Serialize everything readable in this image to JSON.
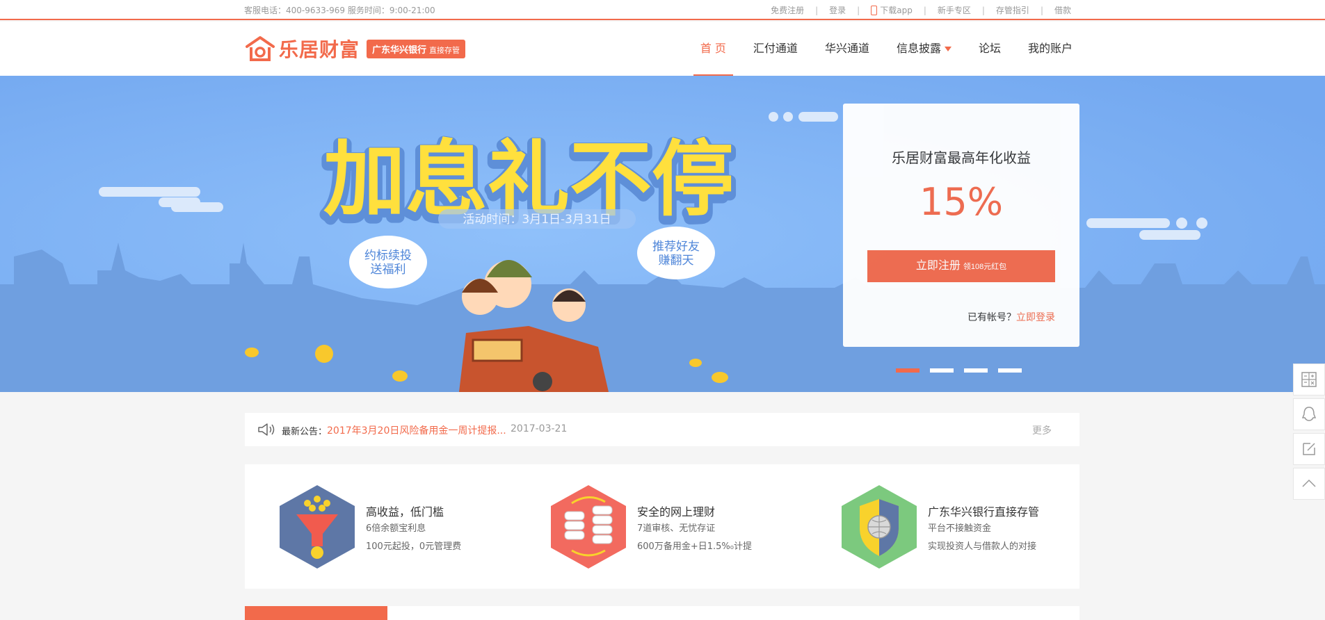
{
  "topbar": {
    "hotline": "客服电话：400-9633-969   服务时间：9:00-21:00",
    "links": [
      "免费注册",
      "登录",
      "下载app",
      "新手专区",
      "存管指引",
      "借款"
    ]
  },
  "logo": {
    "name": "乐居财富",
    "badge": "广东华兴银行",
    "badge_sub": "直接存管"
  },
  "nav": {
    "items": [
      "首 页",
      "汇付通道",
      "华兴通道",
      "信息披露",
      "论坛",
      "我的账户"
    ],
    "active_index": 0
  },
  "banner": {
    "headline": "加息礼不停",
    "activity": "活动时间：3月1日-3月31日",
    "bubble_left": [
      "约标续投",
      "送福利"
    ],
    "bubble_right": [
      "推荐好友",
      "赚翻天"
    ],
    "slide_count": 4,
    "active_slide": 0
  },
  "panel": {
    "title": "乐居财富最高年化收益",
    "rate": "15%",
    "register_label": "立即注册",
    "register_sub": "领108元红包",
    "have_account": "已有帐号？",
    "login_link": "立即登录"
  },
  "notice": {
    "label": "最新公告：",
    "link": "2017年3月20日风险备用金一周计提报...",
    "date": "2017-03-21",
    "more": "更多"
  },
  "features": [
    {
      "title": "高收益，低门槛",
      "line1": "6倍余额宝利息",
      "line2": "100元起投，0元管理费",
      "icon": "funnel-icon",
      "color": "#5e77a6"
    },
    {
      "title": "安全的网上理财",
      "line1": "7道审核、无忧存证",
      "line2": "600万备用金+日1.5%₀计提",
      "icon": "database-icon",
      "color": "#f26a5f"
    },
    {
      "title": "广东华兴银行直接存管",
      "line1": "平台不接触资金",
      "line2": "实现投资人与借款人的对接",
      "icon": "shield-icon",
      "color": "#7cc97e"
    }
  ],
  "colors": {
    "accent": "#f26a4b",
    "banner": "#7fb4f6"
  }
}
